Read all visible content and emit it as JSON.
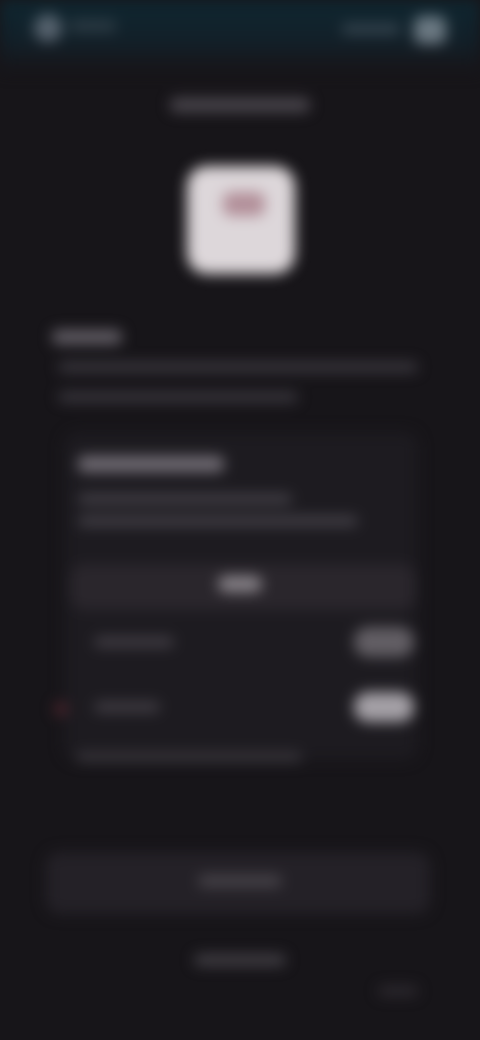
{
  "screen": {
    "title": "",
    "accent": "#0f2630",
    "background": "#171519",
    "icon_accent": "#b28f99",
    "blurred": true
  },
  "header": {
    "app_name": "",
    "action_text": ""
  },
  "main": {
    "title": "",
    "section_title": "",
    "description": [
      "",
      ""
    ],
    "panel": {
      "heading": "",
      "lines": [
        "",
        ""
      ],
      "toggle_label": "",
      "options": [
        {
          "label": "",
          "button": ""
        },
        {
          "label": "",
          "button": ""
        }
      ],
      "footnote": ""
    },
    "bottom_card": {
      "label": ""
    },
    "bottom_link": "",
    "corner_mark": ""
  }
}
